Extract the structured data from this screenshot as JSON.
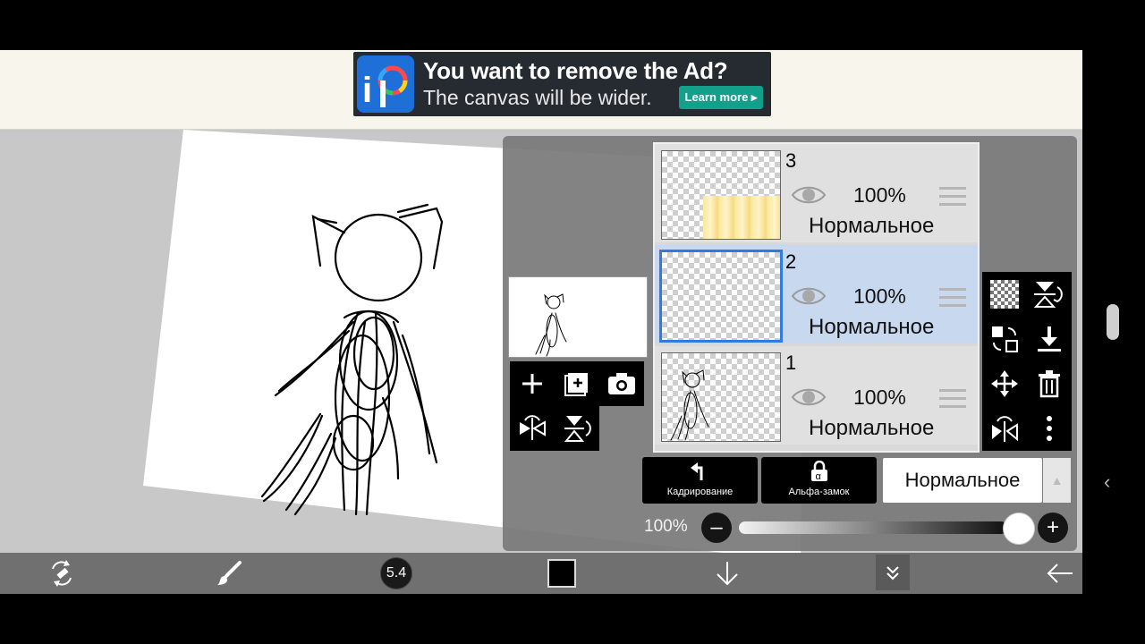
{
  "ad": {
    "title": "You want to remove the Ad?",
    "subtitle": "The canvas will be wider.",
    "button": "Learn more ▸",
    "logo_text": "iP"
  },
  "layers": [
    {
      "number": "3",
      "opacity": "100%",
      "blend_mode": "Нормальное",
      "selected": false
    },
    {
      "number": "2",
      "opacity": "100%",
      "blend_mode": "Нормальное",
      "selected": true
    },
    {
      "number": "1",
      "opacity": "100%",
      "blend_mode": "Нормальное",
      "selected": false
    }
  ],
  "panel": {
    "crop_label": "Кадрирование",
    "alpha_lock_label": "Альфа-замок",
    "blend_mode": "Нормальное",
    "opacity_label": "100%",
    "opacity_value": 1.0
  },
  "toolbar": {
    "brush_size": "5.4",
    "color": "#000000"
  },
  "colors": {
    "selection": "#2f7be0",
    "selected_row": "#c8d8ee",
    "ad_button": "#12a08a"
  }
}
